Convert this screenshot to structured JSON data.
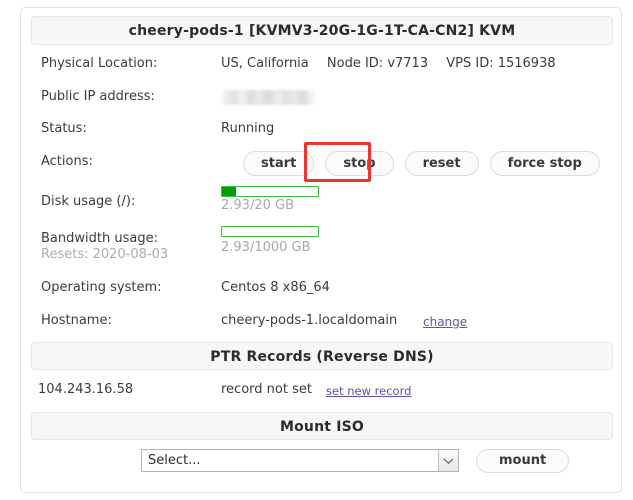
{
  "card": {
    "title": "cheery-pods-1   [KVMV3-20G-1G-1T-CA-CN2]   KVM"
  },
  "details": {
    "physical_location_label": "Physical Location:",
    "physical_location_value": "US, California",
    "node_id_value": "Node ID: v7713",
    "vps_id_value": "VPS ID: 1516938",
    "public_ip_label": "Public IP address:",
    "public_ip_value": "",
    "status_label": "Status:",
    "status_value": "Running",
    "actions_label": "Actions:",
    "disk_label": "Disk usage (/):",
    "disk_text": "2.93/20 GB",
    "disk_percent": 15,
    "bandwidth_label": "Bandwidth usage:",
    "bandwidth_resets": "Resets: 2020-08-03",
    "bandwidth_text": "2.93/1000 GB",
    "bandwidth_percent": 0,
    "os_label": "Operating system:",
    "os_value": "Centos 8 x86_64",
    "hostname_label": "Hostname:",
    "hostname_value": "cheery-pods-1.localdomain",
    "hostname_change_link": "change"
  },
  "actions": {
    "start": "start",
    "stop": "stop",
    "reset": "reset",
    "force_stop": "force stop",
    "highlighted": "stop"
  },
  "ptr": {
    "heading": "PTR Records (Reverse DNS)",
    "ip": "104.243.16.58",
    "record_status": "record not set",
    "set_link": "set new record"
  },
  "iso": {
    "heading": "Mount ISO",
    "select_value": "Select...",
    "mount_button": "mount"
  },
  "colors": {
    "accent_green": "#01a001",
    "bar_border_green": "#41bf41",
    "highlight_red": "#e8352e",
    "link_purple": "#6b4fa8",
    "muted_text": "#a9a9a9"
  }
}
